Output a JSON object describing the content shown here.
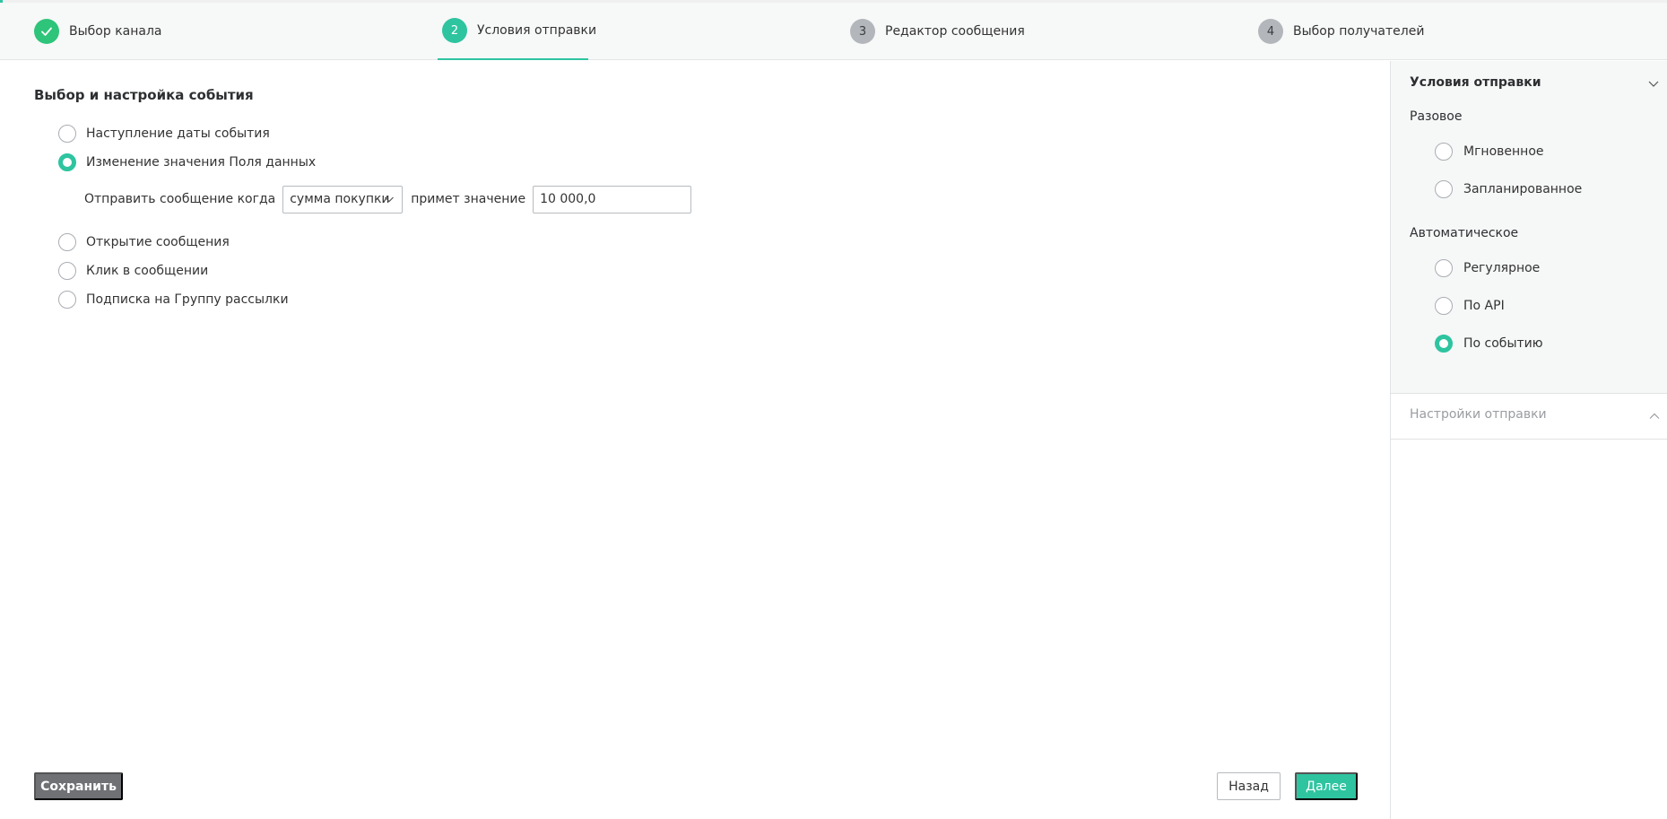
{
  "stepper": {
    "steps": [
      {
        "number": "",
        "label": "Выбор канала",
        "state": "done"
      },
      {
        "number": "2",
        "label": "Условия отправки",
        "state": "active"
      },
      {
        "number": "3",
        "label": "Редактор сообщения",
        "state": "todo"
      },
      {
        "number": "4",
        "label": "Выбор получателей",
        "state": "todo"
      }
    ]
  },
  "main": {
    "title": "Выбор и настройка события",
    "options": [
      {
        "label": "Наступление даты события",
        "checked": false
      },
      {
        "label": "Изменение значения Поля данных",
        "checked": true
      },
      {
        "label": "Открытие сообщения",
        "checked": false
      },
      {
        "label": "Клик в сообщении",
        "checked": false
      },
      {
        "label": "Подписка на Группу рассылки",
        "checked": false
      }
    ],
    "condition": {
      "prefix": "Отправить сообщение когда",
      "field_value": "сумма покупки",
      "middle": "примет значение",
      "value": "10 000,0"
    }
  },
  "buttons": {
    "save": "Сохранить",
    "back": "Назад",
    "next": "Далее"
  },
  "sidebar": {
    "title": "Условия отправки",
    "groups": [
      {
        "label": "Разовое",
        "options": [
          {
            "label": "Мгновенное",
            "checked": false
          },
          {
            "label": "Запланированное",
            "checked": false
          }
        ]
      },
      {
        "label": "Автоматическое",
        "options": [
          {
            "label": "Регулярное",
            "checked": false
          },
          {
            "label": "По API",
            "checked": false
          },
          {
            "label": "По событию",
            "checked": true
          }
        ]
      }
    ],
    "settings_title": "Настройки отправки"
  },
  "colors": {
    "accent": "#2ec4a0",
    "done": "#2ec47a",
    "save_button": "#6f7175"
  }
}
